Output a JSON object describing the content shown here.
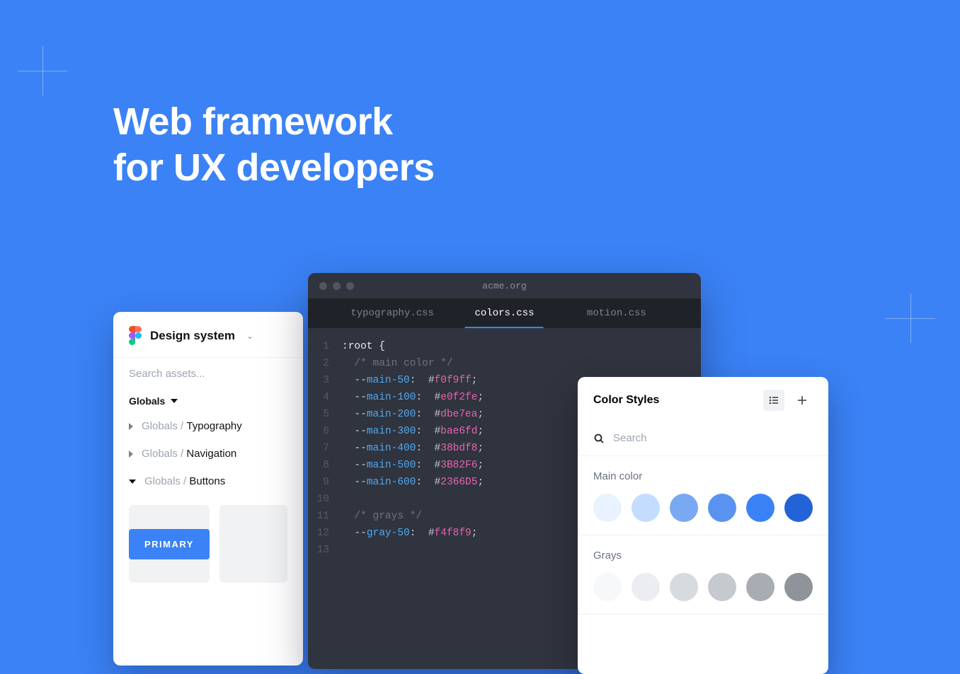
{
  "hero": {
    "line1": "Web framework",
    "line2": "for UX developers"
  },
  "design_panel": {
    "title": "Design system",
    "search_placeholder": "Search assets...",
    "section": "Globals",
    "items": [
      {
        "path": "Globals / ",
        "leaf": "Typography",
        "expanded": false
      },
      {
        "path": "Globals / ",
        "leaf": "Navigation",
        "expanded": false
      },
      {
        "path": "Globals / ",
        "leaf": "Buttons",
        "expanded": true
      }
    ],
    "primary_button": "PRIMARY"
  },
  "editor": {
    "window_title": "acme.org",
    "tabs": [
      {
        "label": "typography.css",
        "active": false
      },
      {
        "label": "colors.css",
        "active": true
      },
      {
        "label": "motion.css",
        "active": false
      }
    ],
    "code": [
      {
        "n": 1,
        "sel": ":root {"
      },
      {
        "n": 2,
        "comment": "  /* main color */"
      },
      {
        "n": 3,
        "var": "main-50",
        "hex": "f0f9ff"
      },
      {
        "n": 4,
        "var": "main-100",
        "hex": "e0f2fe"
      },
      {
        "n": 5,
        "var": "main-200",
        "hex": "dbe7ea"
      },
      {
        "n": 6,
        "var": "main-300",
        "hex": "bae6fd"
      },
      {
        "n": 7,
        "var": "main-400",
        "hex": "38bdf8"
      },
      {
        "n": 8,
        "var": "main-500",
        "hex": "3B82F6"
      },
      {
        "n": 9,
        "var": "main-600",
        "hex": "2366D5"
      },
      {
        "n": 10,
        "blank": true
      },
      {
        "n": 11,
        "comment": "  /* grays */"
      },
      {
        "n": 12,
        "var": "gray-50",
        "hex": "f4f8f9"
      },
      {
        "n": 13,
        "blank": true
      }
    ]
  },
  "color_styles": {
    "title": "Color Styles",
    "search_placeholder": "Search",
    "groups": [
      {
        "name": "Main color",
        "colors": [
          "#e9f2ff",
          "#c3dcff",
          "#79a9f2",
          "#5a93ef",
          "#3b82f6",
          "#2363d8"
        ]
      },
      {
        "name": "Grays",
        "colors": [
          "#f7f8f9",
          "#ebedf0",
          "#d7dade",
          "#c6c9ce",
          "#a9acb2",
          "#8f939a"
        ]
      }
    ]
  }
}
